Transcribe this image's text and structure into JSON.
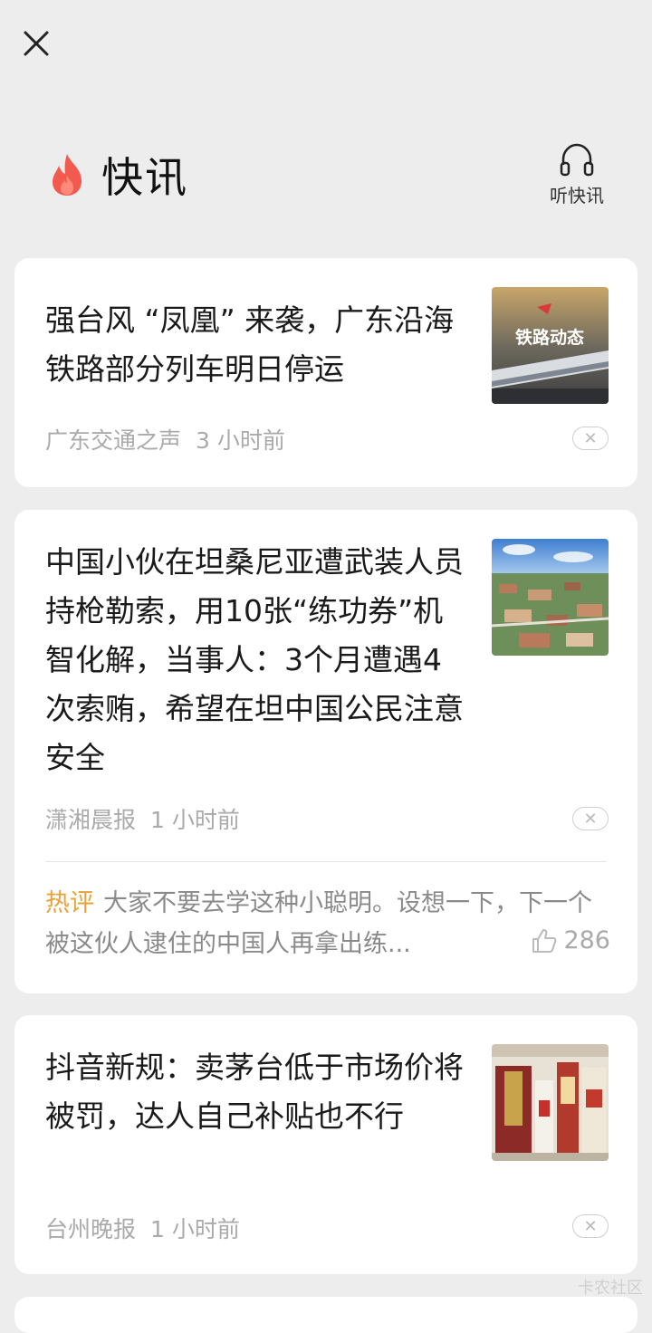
{
  "header": {
    "title": "快讯",
    "listen_label": "听快讯"
  },
  "items": [
    {
      "title": "强台风 “凤凰” 来袭，广东沿海铁路部分列车明日停运",
      "source": "广东交通之声",
      "time": "3 小时前",
      "thumb_text": "铁路动态"
    },
    {
      "title": "中国小伙在坦桑尼亚遭武装人员持枪勒索，用10张“练功券”机智化解，当事人：3个月遭遇4次索贿，希望在坦中国公民注意安全",
      "source": "潇湘晨报",
      "time": "1 小时前",
      "hot_label": "热评",
      "hot_comment": "大家不要去学这种小聪明。设想一下，下一个被这伙人逮住的中国人再拿出练...",
      "likes": "286"
    },
    {
      "title": "抖音新规：卖茅台低于市场价将被罚，达人自己补贴也不行",
      "source": "台州晚报",
      "time": "1 小时前"
    }
  ],
  "watermark": "卡农社区",
  "colors": {
    "accent_flame": "#f25a50",
    "hot_label": "#e8a23b",
    "background": "#ededed"
  }
}
